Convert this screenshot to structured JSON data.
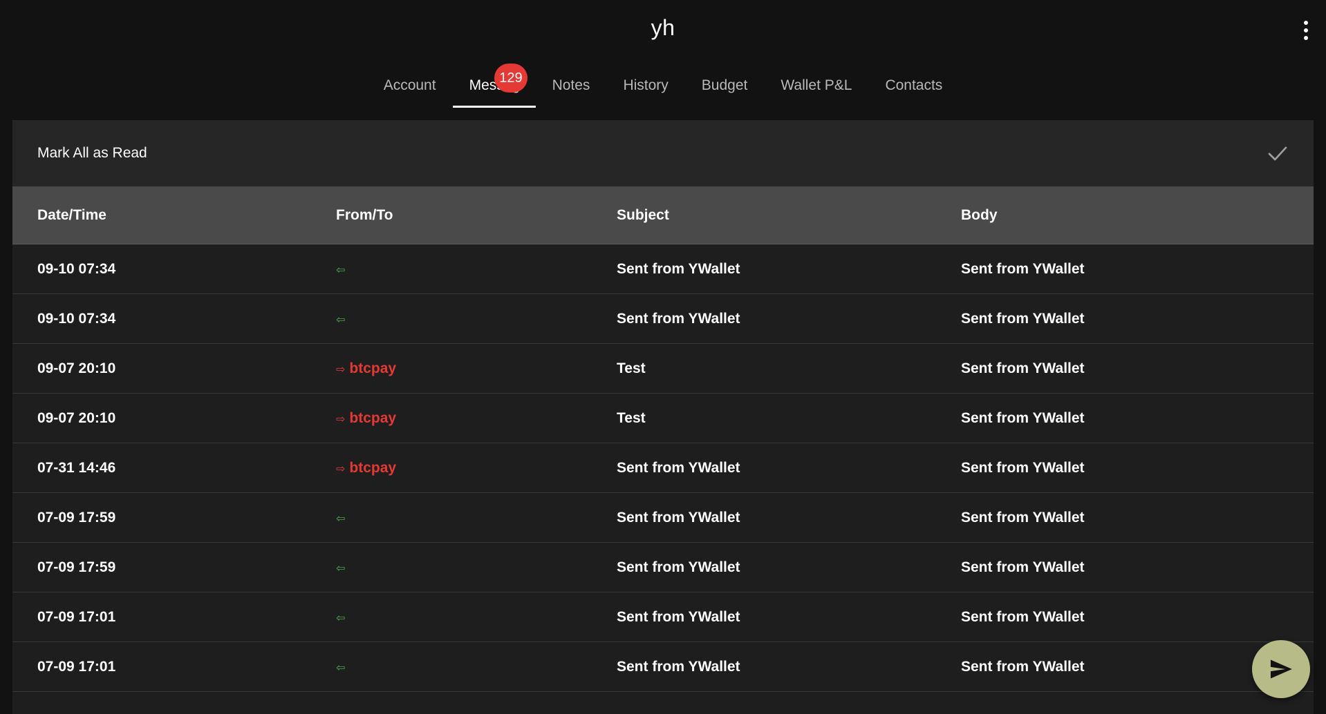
{
  "header": {
    "title": "yh"
  },
  "tabs": [
    {
      "label": "Account",
      "active": false
    },
    {
      "label": "Messages",
      "active": true,
      "badge": "129"
    },
    {
      "label": "Notes",
      "active": false
    },
    {
      "label": "History",
      "active": false
    },
    {
      "label": "Budget",
      "active": false
    },
    {
      "label": "Wallet P&L",
      "active": false
    },
    {
      "label": "Contacts",
      "active": false
    }
  ],
  "toolbar": {
    "mark_all_label": "Mark All as Read"
  },
  "table": {
    "columns": [
      "Date/Time",
      "From/To",
      "Subject",
      "Body"
    ],
    "rows": [
      {
        "datetime": "09-10 07:34",
        "direction": "in",
        "arrow": "⇦",
        "party": "",
        "subject": "Sent from YWallet",
        "body": "Sent from YWallet"
      },
      {
        "datetime": "09-10 07:34",
        "direction": "in",
        "arrow": "⇦",
        "party": "",
        "subject": "Sent from YWallet",
        "body": "Sent from YWallet"
      },
      {
        "datetime": "09-07 20:10",
        "direction": "out",
        "arrow": "⇨",
        "party": "btcpay",
        "subject": "Test",
        "body": "Sent from YWallet"
      },
      {
        "datetime": "09-07 20:10",
        "direction": "out",
        "arrow": "⇨",
        "party": "btcpay",
        "subject": "Test",
        "body": "Sent from YWallet"
      },
      {
        "datetime": "07-31 14:46",
        "direction": "out",
        "arrow": "⇨",
        "party": "btcpay",
        "subject": "Sent from YWallet",
        "body": "Sent from YWallet"
      },
      {
        "datetime": "07-09 17:59",
        "direction": "in",
        "arrow": "⇦",
        "party": "",
        "subject": "Sent from YWallet",
        "body": "Sent from YWallet"
      },
      {
        "datetime": "07-09 17:59",
        "direction": "in",
        "arrow": "⇦",
        "party": "",
        "subject": "Sent from YWallet",
        "body": "Sent from YWallet"
      },
      {
        "datetime": "07-09 17:01",
        "direction": "in",
        "arrow": "⇦",
        "party": "",
        "subject": "Sent from YWallet",
        "body": "Sent from YWallet"
      },
      {
        "datetime": "07-09 17:01",
        "direction": "in",
        "arrow": "⇦",
        "party": "",
        "subject": "Sent from YWallet",
        "body": "Sent from YWallet"
      }
    ]
  },
  "icons": {
    "menu": "more-vertical-icon",
    "mark_read": "check-icon",
    "fab": "send-icon"
  },
  "colors": {
    "background": "#121212",
    "card": "#1e1e1e",
    "header_row": "#4a4a4a",
    "accent_red": "#e53935",
    "incoming_green": "#4caf50",
    "fab": "#b6bb87"
  }
}
